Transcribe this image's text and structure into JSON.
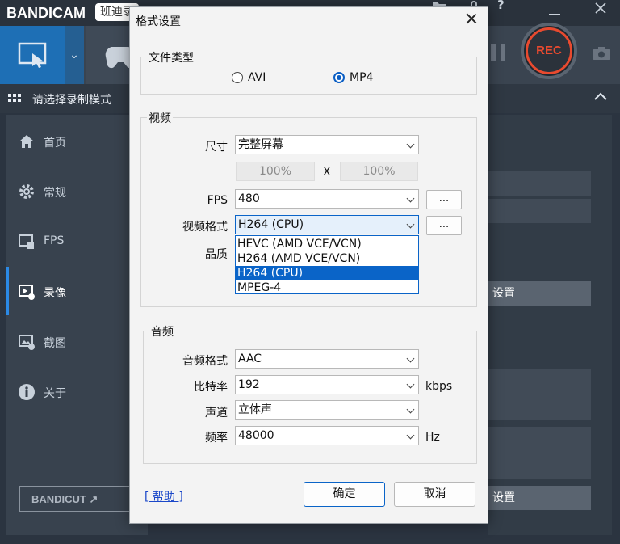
{
  "app": {
    "logo_text": "BANDICAM",
    "subtitle": "班迪录",
    "mode_bar_label": "请选择录制模式",
    "rec_label": "REC",
    "sidebar": [
      {
        "label": "首页",
        "icon": "home-icon"
      },
      {
        "label": "常规",
        "icon": "gear-icon"
      },
      {
        "label": "FPS",
        "icon": "fps-icon"
      },
      {
        "label": "录像",
        "icon": "video-icon"
      },
      {
        "label": "截图",
        "icon": "image-icon"
      },
      {
        "label": "关于",
        "icon": "info-icon"
      }
    ],
    "bandicut_label": "BANDICUT ↗",
    "right_settings_label": "设置",
    "right_settings_label_bottom": "设置"
  },
  "dialog": {
    "title": "格式设置",
    "file_type": {
      "group_label": "文件类型",
      "options": [
        "AVI",
        "MP4"
      ],
      "selected": "MP4"
    },
    "video": {
      "group_label": "视频",
      "size_label": "尺寸",
      "size_value": "完整屏幕",
      "width_pct": "100%",
      "x_sep": "X",
      "height_pct": "100%",
      "fps_label": "FPS",
      "fps_value": "480",
      "codec_label": "视频格式",
      "codec_value": "H264 (CPU)",
      "quality_label": "品质",
      "more_button": "...",
      "codec_options": [
        "HEVC (AMD VCE/VCN)",
        "H264 (AMD VCE/VCN)",
        "H264 (CPU)",
        "MPEG-4"
      ],
      "codec_selected_index": 2
    },
    "audio": {
      "group_label": "音频",
      "format_label": "音频格式",
      "format_value": "AAC",
      "bitrate_label": "比特率",
      "bitrate_value": "192",
      "bitrate_unit": "kbps",
      "channel_label": "声道",
      "channel_value": "立体声",
      "freq_label": "频率",
      "freq_value": "48000",
      "freq_unit": "Hz"
    },
    "help_link": "[ 帮助 ]",
    "ok_button": "确定",
    "cancel_button": "取消"
  },
  "colors": {
    "accent": "#0a64c8",
    "rec_red": "#e84a2f",
    "app_blue": "#1e6fb5"
  }
}
